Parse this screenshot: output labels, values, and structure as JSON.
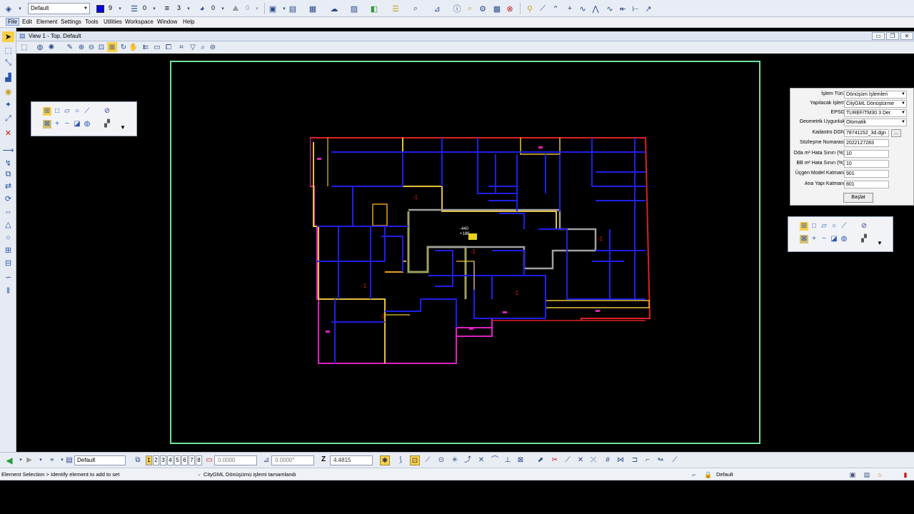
{
  "toolbar": {
    "level_combo": "Default",
    "color_value": "9",
    "linestyle_value": "0",
    "weight_value": "3",
    "transparency_value": "0",
    "priority_value": "0"
  },
  "menu": {
    "items": [
      "File",
      "Edit",
      "Element",
      "Settings",
      "Tools",
      "Utilities",
      "Workspace",
      "Window",
      "Help"
    ]
  },
  "view": {
    "title": "View 1 - Top, Default"
  },
  "form": {
    "rows": [
      {
        "label": "İşlem Türü",
        "value": "Dönüşüm İşlemleri",
        "type": "select"
      },
      {
        "label": "Yapılacak İşlem",
        "value": "CityGML Dönüştürme",
        "type": "select"
      },
      {
        "label": "EPSG",
        "value": "TUREF/TM30 3 Der.",
        "type": "select"
      },
      {
        "label": "Geometrik Uygunluk",
        "value": "Otomatik",
        "type": "select"
      },
      {
        "label": "Kadastro DGN",
        "value": "78741152_3d.dgn",
        "type": "file"
      },
      {
        "label": "Sözleşme Numarası",
        "value": "2022127283",
        "type": "text"
      },
      {
        "label": "Oda m² Hata Sınırı (%)",
        "value": "10",
        "type": "text"
      },
      {
        "label": "BB m² Hata Sınırı (%)",
        "value": "10",
        "type": "text"
      },
      {
        "label": "Üçgen Model Katmanı",
        "value": "901",
        "type": "text"
      },
      {
        "label": "Ana Yapı Katmanı",
        "value": "801",
        "type": "text"
      }
    ],
    "browse_label": "...",
    "start_label": "Başlat"
  },
  "plan_labels": {
    "center_a": "-440",
    "center_b": "+186",
    "minus_one": "-1"
  },
  "bottom": {
    "level_combo": "Default",
    "view_numbers": [
      "1",
      "2",
      "3",
      "4",
      "5",
      "6",
      "7",
      "8"
    ],
    "x_field": "0.0000",
    "angle_field": "0.0000°",
    "z_label": "Z",
    "z_field": "4.4815"
  },
  "status": {
    "left": "Element Selection > Identify element to add to set",
    "message": "CityGML Dönüşümü işlemi tamamlandı",
    "level": "Default"
  },
  "colors": {
    "sheet_border": "#6fe39b",
    "wall_blue": "#1f1fe8",
    "wall_yellow": "#e8c23a",
    "wall_magenta": "#e020c0",
    "wall_red": "#e02020"
  }
}
